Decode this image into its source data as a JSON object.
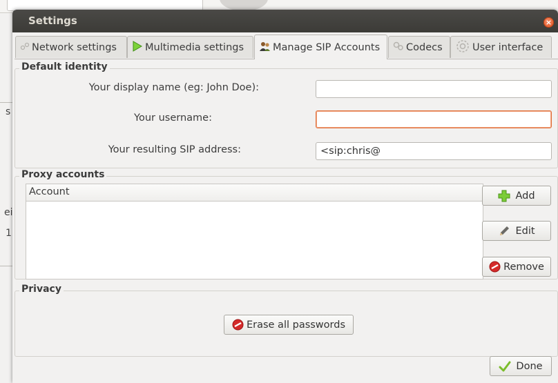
{
  "background": {
    "fragments": [
      "s",
      "ei",
      "1"
    ]
  },
  "dialog": {
    "title": "Settings",
    "close_symbol": "×"
  },
  "tabs": [
    {
      "label": "Network settings",
      "icon": "network-icon"
    },
    {
      "label": "Multimedia settings",
      "icon": "play-icon"
    },
    {
      "label": "Manage SIP Accounts",
      "icon": "accounts-icon",
      "active": true
    },
    {
      "label": "Codecs",
      "icon": "codecs-icon"
    },
    {
      "label": "User interface",
      "icon": "user-interface-icon"
    }
  ],
  "default_identity": {
    "title": "Default identity",
    "display_name_label": "Your display name (eg: John Doe):",
    "display_name_value": "",
    "username_label": "Your username:",
    "username_value": "",
    "sip_address_label": "Your resulting SIP address:",
    "sip_address_value": "<sip:chris@"
  },
  "proxy_accounts": {
    "title": "Proxy accounts",
    "column_header": "Account",
    "rows": [],
    "add_label": "Add",
    "edit_label": "Edit",
    "remove_label": "Remove"
  },
  "privacy": {
    "title": "Privacy",
    "erase_label": "Erase all passwords"
  },
  "footer": {
    "done_label": "Done"
  },
  "colors": {
    "accent": "#e0531f",
    "add_green": "#6fbf2a",
    "remove_red": "#d42a2a",
    "done_green": "#7bbd2b"
  }
}
